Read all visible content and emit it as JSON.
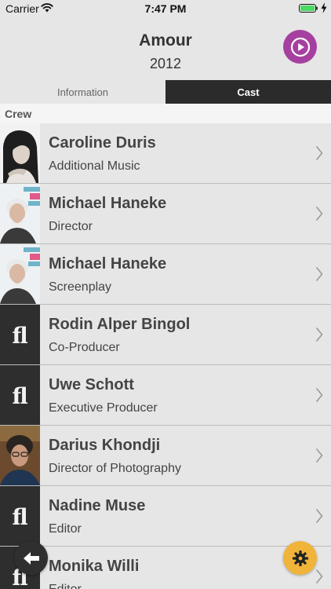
{
  "status_bar": {
    "carrier": "Carrier",
    "time": "7:47 PM"
  },
  "header": {
    "title": "Amour",
    "year": "2012"
  },
  "tabs": [
    {
      "label": "Information",
      "active": false
    },
    {
      "label": "Cast",
      "active": true
    }
  ],
  "section": {
    "label": "Crew"
  },
  "crew": [
    {
      "name": "Caroline Duris",
      "role": "Additional Music",
      "thumb": "portrait-dark-hair"
    },
    {
      "name": "Michael Haneke",
      "role": "Director",
      "thumb": "portrait-grey-hair"
    },
    {
      "name": "Michael Haneke",
      "role": "Screenplay",
      "thumb": "portrait-grey-hair"
    },
    {
      "name": "Rodin Alper Bingol",
      "role": "Co-Producer",
      "thumb": "placeholder-logo"
    },
    {
      "name": "Uwe Schott",
      "role": "Executive Producer",
      "thumb": "placeholder-logo"
    },
    {
      "name": "Darius Khondji",
      "role": "Director of Photography",
      "thumb": "portrait-curly-hair"
    },
    {
      "name": "Nadine Muse",
      "role": "Editor",
      "thumb": "placeholder-logo"
    },
    {
      "name": "Monika Willi",
      "role": "Editor",
      "thumb": "placeholder-logo"
    }
  ],
  "thumb_logo_text": "fl",
  "colors": {
    "play_button": "#a640a0",
    "settings_button": "#f0b43a",
    "back_button": "#2f2f2f",
    "active_tab": "#2b2b2b",
    "battery": "#4cd964"
  },
  "icons": {
    "play": "play-circle-icon",
    "back": "arrow-left-icon",
    "settings": "gear-icon",
    "row_disclosure": "chevron-right-icon"
  }
}
